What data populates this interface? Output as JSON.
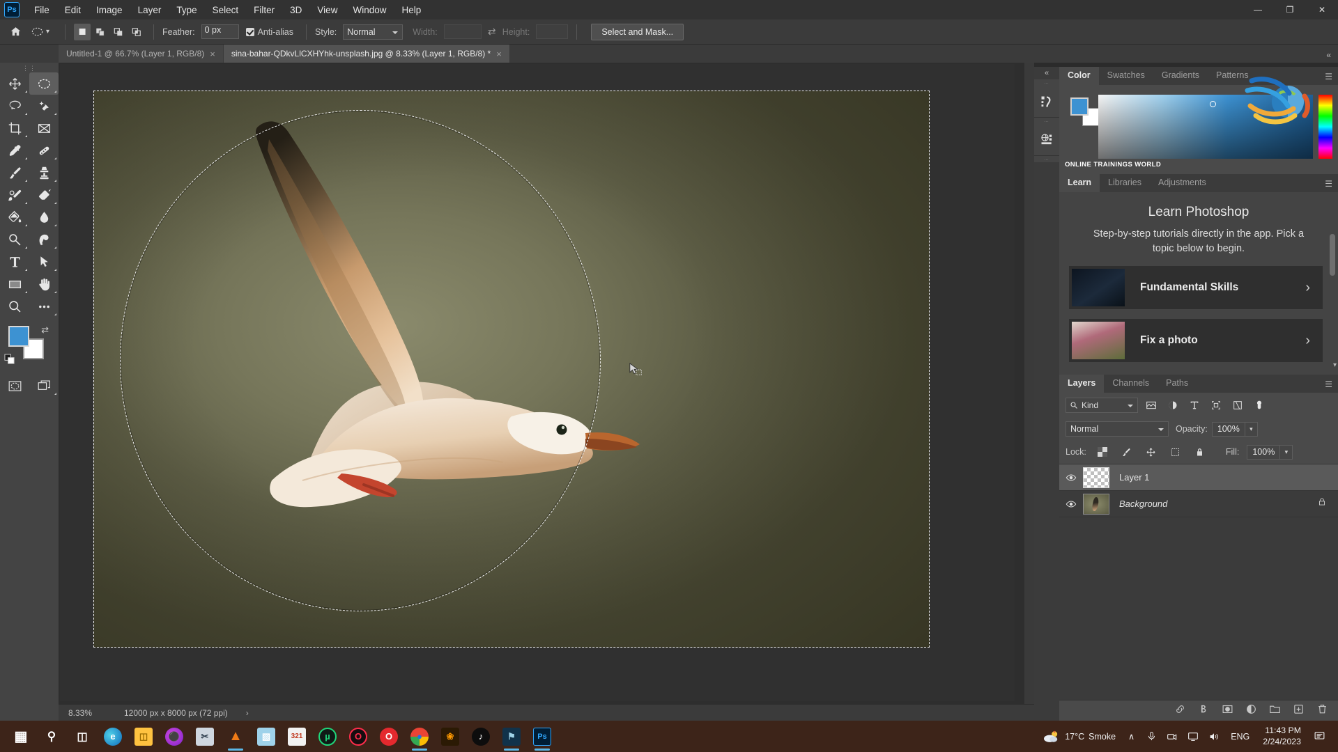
{
  "app": {
    "name": "Adobe Photoshop",
    "logo_text": "Ps"
  },
  "menubar": {
    "items": [
      "File",
      "Edit",
      "Image",
      "Layer",
      "Type",
      "Select",
      "Filter",
      "3D",
      "View",
      "Window",
      "Help"
    ]
  },
  "window_controls": {
    "minimize": "—",
    "maximize": "❐",
    "close": "✕"
  },
  "options_bar": {
    "home_icon": "home-icon",
    "tool_icon": "elliptical-marquee-icon",
    "selection_modes": [
      "new-selection",
      "add-to-selection",
      "subtract-from-selection",
      "intersect-with-selection"
    ],
    "active_selection_mode": "new-selection",
    "feather_label": "Feather:",
    "feather_value": "0 px",
    "antialias_label": "Anti-alias",
    "antialias_checked": true,
    "style_label": "Style:",
    "style_value": "Normal",
    "width_label": "Width:",
    "width_value": "",
    "height_label": "Height:",
    "height_value": "",
    "swap_icon": "swap-width-height-icon",
    "select_and_mask_label": "Select and Mask..."
  },
  "tabs": [
    {
      "title": "Untitled-1 @ 66.7% (Layer 1, RGB/8)",
      "active": false,
      "close": "×"
    },
    {
      "title": "sina-bahar-QDkvLlCXHYhk-unsplash.jpg @ 8.33% (Layer 1, RGB/8) *",
      "active": true,
      "close": "×"
    }
  ],
  "collapse_panels_icon": "«",
  "toolbar": {
    "tools": [
      {
        "name": "move-tool",
        "has_submenu": true
      },
      {
        "name": "elliptical-marquee-tool",
        "has_submenu": true,
        "active": true
      },
      {
        "name": "lasso-tool",
        "has_submenu": true
      },
      {
        "name": "object-selection-tool",
        "has_submenu": true
      },
      {
        "name": "crop-tool",
        "has_submenu": true
      },
      {
        "name": "frame-tool",
        "has_submenu": false
      },
      {
        "name": "eyedropper-tool",
        "has_submenu": true
      },
      {
        "name": "healing-brush-tool",
        "has_submenu": true
      },
      {
        "name": "brush-tool",
        "has_submenu": true
      },
      {
        "name": "clone-stamp-tool",
        "has_submenu": true
      },
      {
        "name": "history-brush-tool",
        "has_submenu": true
      },
      {
        "name": "eraser-tool",
        "has_submenu": true
      },
      {
        "name": "gradient-tool",
        "has_submenu": true
      },
      {
        "name": "blur-tool",
        "has_submenu": true
      },
      {
        "name": "dodge-tool",
        "has_submenu": true
      },
      {
        "name": "pen-tool",
        "has_submenu": true
      },
      {
        "name": "type-tool",
        "has_submenu": true
      },
      {
        "name": "path-selection-tool",
        "has_submenu": true
      },
      {
        "name": "rectangle-tool",
        "has_submenu": true
      },
      {
        "name": "hand-tool",
        "has_submenu": true
      },
      {
        "name": "zoom-tool",
        "has_submenu": false
      },
      {
        "name": "edit-toolbar-tool",
        "has_submenu": true
      }
    ],
    "foreground_color": "#3d92d2",
    "background_color": "#ffffff",
    "swap_colors_icon": "swap-colors-icon",
    "default_colors_icon": "default-colors-icon",
    "quick_mask_icon": "quick-mask-icon",
    "screen_mode_icon": "screen-mode-icon"
  },
  "canvas": {
    "document_name": "sina-bahar-QDkvLlCXHYhk-unsplash.jpg",
    "selection_shape": "ellipse",
    "photo_subject": "seagull-in-flight"
  },
  "status_bar": {
    "zoom": "8.33%",
    "dimensions": "12000 px x 8000 px (72 ppi)",
    "arrow": "›"
  },
  "right_rail": {
    "buttons": [
      "libraries-icon",
      "3d-icon"
    ]
  },
  "color_panel": {
    "tabs": [
      "Color",
      "Swatches",
      "Gradients",
      "Patterns"
    ],
    "active_tab": "Color",
    "foreground_color": "#3d92d2",
    "background_color": "#ffffff",
    "menu_icon": "panel-menu-icon",
    "watermark_text": "ONLINE TRAININGS WORLD"
  },
  "learn_panel": {
    "tabs": [
      "Learn",
      "Libraries",
      "Adjustments"
    ],
    "active_tab": "Learn",
    "title": "Learn Photoshop",
    "subtitle": "Step-by-step tutorials directly in the app. Pick a topic below to begin.",
    "cards": [
      {
        "label": "Fundamental Skills",
        "chevron": "›"
      },
      {
        "label": "Fix a photo",
        "chevron": "›"
      }
    ]
  },
  "layers_panel": {
    "tabs": [
      "Layers",
      "Channels",
      "Paths"
    ],
    "active_tab": "Layers",
    "menu_icon": "panel-menu-icon",
    "filter_label": "Kind",
    "filter_icons": [
      "pixel-layers-filter-icon",
      "adjustment-layers-filter-icon",
      "type-layers-filter-icon",
      "shape-layers-filter-icon",
      "smart-object-filter-icon",
      "filter-toggle-icon"
    ],
    "blend_mode": "Normal",
    "opacity_label": "Opacity:",
    "opacity_value": "100%",
    "lock_label": "Lock:",
    "lock_icons": [
      "lock-transparent-pixels-icon",
      "lock-image-pixels-icon",
      "lock-position-icon",
      "lock-artboard-nesting-icon",
      "lock-all-icon"
    ],
    "fill_label": "Fill:",
    "fill_value": "100%",
    "layers": [
      {
        "name": "Layer 1",
        "visible": true,
        "selected": true,
        "locked": false,
        "thumb": "transparent",
        "italic": false
      },
      {
        "name": "Background",
        "visible": true,
        "selected": false,
        "locked": true,
        "thumb": "photo",
        "italic": true
      }
    ],
    "bottom_icons": [
      "link-layers-icon",
      "layer-style-icon",
      "layer-mask-icon",
      "new-adjustment-layer-icon",
      "new-group-icon",
      "new-layer-icon",
      "delete-layer-icon"
    ]
  },
  "taskbar": {
    "items": [
      {
        "name": "start-button",
        "glyph": "⊞",
        "color": "#ffffff",
        "bg": "transparent",
        "active": false
      },
      {
        "name": "search-icon",
        "glyph": "⚲",
        "color": "#ffffff",
        "bg": "transparent",
        "active": false
      },
      {
        "name": "task-view-icon",
        "glyph": "⌸",
        "color": "#ffffff",
        "bg": "transparent",
        "active": false
      },
      {
        "name": "microsoft-edge-icon",
        "glyph": "e",
        "color": "#ffffff",
        "bg": "#1b8fd1",
        "active": false
      },
      {
        "name": "file-explorer-icon",
        "glyph": "▤",
        "color": "#2a2a2a",
        "bg": "#ffc240",
        "active": false
      },
      {
        "name": "firefox-icon",
        "glyph": "◉",
        "color": "#ffffff",
        "bg": "#9b30d9",
        "active": false
      },
      {
        "name": "snipping-tool-icon",
        "glyph": "✂",
        "color": "#2a2a2a",
        "bg": "#cfd7e0",
        "active": false
      },
      {
        "name": "vlc-media-player-icon",
        "glyph": "▲",
        "color": "#ffffff",
        "bg": "#f07b17",
        "active": true
      },
      {
        "name": "microsoft-store-icon",
        "glyph": "◧",
        "color": "#ffffff",
        "bg": "#9fd2ea",
        "active": false
      },
      {
        "name": "calendar-icon",
        "glyph": "321",
        "color": "#2a2a2a",
        "bg": "#f2f2f2",
        "active": false
      },
      {
        "name": "utorrent-icon",
        "glyph": "µ",
        "color": "#1fd67a",
        "bg": "#0f1a16",
        "active": false
      },
      {
        "name": "opera-gx-icon",
        "glyph": "O",
        "color": "#ff2d4b",
        "bg": "#150d10",
        "active": false
      },
      {
        "name": "opera-icon",
        "glyph": "O",
        "color": "#ffffff",
        "bg": "#e4292e",
        "active": false
      },
      {
        "name": "google-chrome-icon",
        "glyph": "●",
        "color": "#ffffff",
        "bg": "#1aa260",
        "active": true
      },
      {
        "name": "adobe-illustrator-icon",
        "glyph": "❀",
        "color": "#ff9a00",
        "bg": "#2b1a04",
        "active": false
      },
      {
        "name": "tiktok-icon",
        "glyph": "♪",
        "color": "#ffffff",
        "bg": "#0d0d0d",
        "active": false
      },
      {
        "name": "adobe-premiere-icon",
        "glyph": "⚑",
        "color": "#9fd3e8",
        "bg": "#11324a",
        "active": true
      },
      {
        "name": "adobe-photoshop-icon",
        "glyph": "Ps",
        "color": "#31a8ff",
        "bg": "#001e36",
        "active": true
      }
    ],
    "tray": {
      "weather_icon": "weather-cloud-icon",
      "temperature": "17°C",
      "condition": "Smoke",
      "overflow_icon": "∧",
      "icons": [
        "microphone-icon",
        "camera-icon",
        "display-icon",
        "volume-icon"
      ],
      "language": "ENG",
      "time": "11:43 PM",
      "date": "2/24/2023",
      "notifications_icon": "notifications-icon"
    }
  }
}
